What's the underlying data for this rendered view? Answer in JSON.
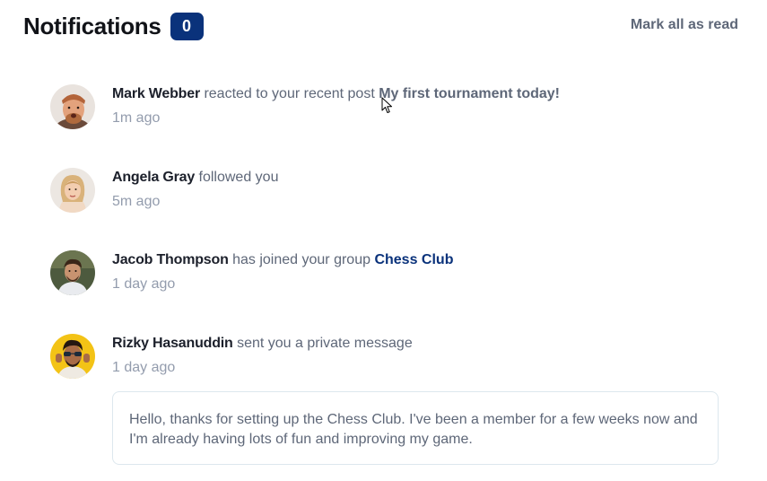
{
  "header": {
    "title": "Notifications",
    "unread_count": "0",
    "mark_all_label": "Mark all as read"
  },
  "notifications": [
    {
      "user": "Mark Webber",
      "action": "reacted to your recent post",
      "target": "My first tournament today!",
      "time": "1m ago",
      "avatar": "avatar-mark-webber"
    },
    {
      "user": "Angela Gray",
      "action": "followed you",
      "target": "",
      "time": "5m ago",
      "avatar": "avatar-angela-gray"
    },
    {
      "user": "Jacob Thompson",
      "action": "has joined your group",
      "target": "Chess Club",
      "time": "1 day ago",
      "avatar": "avatar-jacob-thompson"
    },
    {
      "user": "Rizky Hasanuddin",
      "action": "sent you a private message",
      "target": "",
      "time": "1 day ago",
      "avatar": "avatar-rizky-hasanuddin",
      "message": "Hello, thanks for setting up the Chess Club. I've been a member for a few weeks now and I'm already having lots of fun and improving my game."
    }
  ],
  "colors": {
    "badge_bg": "#0a327b",
    "text_dark": "#1c202b",
    "text_muted": "#5e6778",
    "text_light": "#939cad",
    "group_link": "#0a327b",
    "message_border": "#dde7ee"
  },
  "icons": {
    "cursor": "arrow-pointer-icon"
  }
}
